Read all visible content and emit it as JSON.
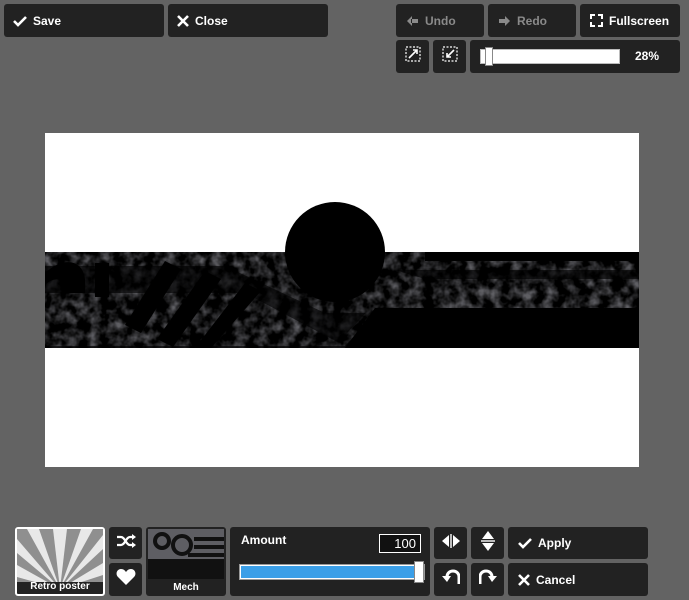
{
  "toolbar": {
    "save_label": "Save",
    "close_label": "Close",
    "undo_label": "Undo",
    "redo_label": "Redo",
    "fullscreen_label": "Fullscreen"
  },
  "zoom": {
    "value_label": "28%",
    "fraction": 0.28
  },
  "filters": {
    "presets": [
      {
        "label": "Retro poster"
      },
      {
        "label": "Mech"
      }
    ]
  },
  "amount": {
    "label": "Amount",
    "value": "100",
    "fraction": 1.0
  },
  "actions": {
    "apply_label": "Apply",
    "cancel_label": "Cancel"
  },
  "colors": {
    "background": "#636363",
    "panel": "#222222",
    "slider_fill": "#3b9fe8",
    "texture": "#5e5e63"
  }
}
